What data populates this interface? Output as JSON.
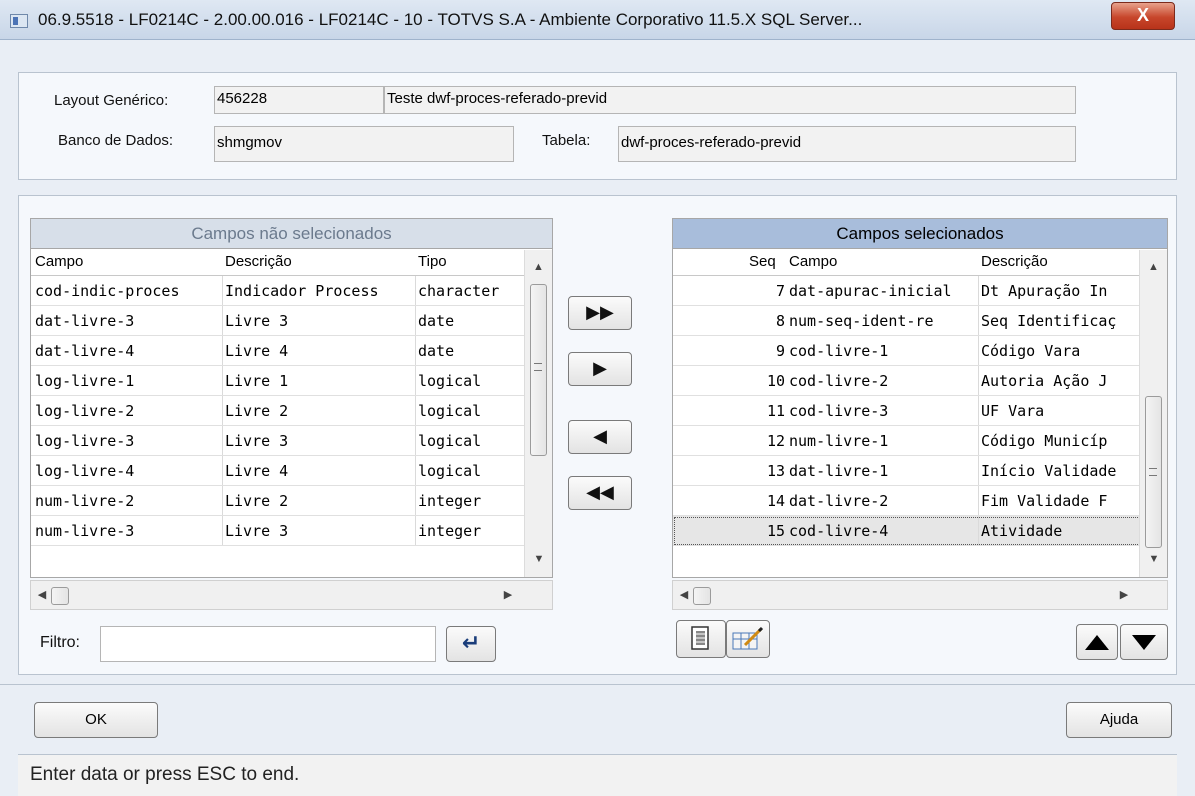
{
  "window": {
    "title": "06.9.5518 - LF0214C - 2.00.00.016 - LF0214C - 10 - TOTVS S.A - Ambiente Corporativo 11.5.X SQL Server...",
    "close_glyph": "X"
  },
  "header": {
    "layout_label": "Layout Genérico:",
    "layout_code": "456228",
    "layout_desc": "Teste dwf-proces-referado-previd",
    "db_label": "Banco de Dados:",
    "db_value": "shmgmov",
    "table_label": "Tabela:",
    "table_value": "dwf-proces-referado-previd"
  },
  "available": {
    "title": "Campos não selecionados",
    "columns": [
      "Campo",
      "Descrição",
      "Tipo"
    ],
    "rows": [
      {
        "campo": "cod-indic-proces",
        "desc": "Indicador Process",
        "tipo": "character"
      },
      {
        "campo": "dat-livre-3",
        "desc": "Livre 3",
        "tipo": "date"
      },
      {
        "campo": "dat-livre-4",
        "desc": "Livre 4",
        "tipo": "date"
      },
      {
        "campo": "log-livre-1",
        "desc": "Livre 1",
        "tipo": "logical"
      },
      {
        "campo": "log-livre-2",
        "desc": "Livre 2",
        "tipo": "logical"
      },
      {
        "campo": "log-livre-3",
        "desc": "Livre 3",
        "tipo": "logical"
      },
      {
        "campo": "log-livre-4",
        "desc": "Livre 4",
        "tipo": "logical"
      },
      {
        "campo": "num-livre-2",
        "desc": "Livre 2",
        "tipo": "integer"
      },
      {
        "campo": "num-livre-3",
        "desc": "Livre 3",
        "tipo": "integer"
      }
    ]
  },
  "selected": {
    "title": "Campos selecionados",
    "columns": [
      "Seq",
      "Campo",
      "Descrição"
    ],
    "rows": [
      {
        "seq": "7",
        "campo": "dat-apurac-inicial",
        "desc": "Dt Apuração In"
      },
      {
        "seq": "8",
        "campo": "num-seq-ident-re",
        "desc": "Seq Identificaç"
      },
      {
        "seq": "9",
        "campo": "cod-livre-1",
        "desc": "Código Vara"
      },
      {
        "seq": "10",
        "campo": "cod-livre-2",
        "desc": "Autoria Ação J"
      },
      {
        "seq": "11",
        "campo": "cod-livre-3",
        "desc": "UF Vara"
      },
      {
        "seq": "12",
        "campo": "num-livre-1",
        "desc": "Código Municíp"
      },
      {
        "seq": "13",
        "campo": "dat-livre-1",
        "desc": "Início Validade"
      },
      {
        "seq": "14",
        "campo": "dat-livre-2",
        "desc": "Fim Validade F"
      },
      {
        "seq": "15",
        "campo": "cod-livre-4",
        "desc": "Atividade"
      }
    ],
    "selected_index": 8
  },
  "move_buttons": {
    "add_all": "▶▶",
    "add_one": "▶",
    "remove_one": "◀",
    "remove_all": "◀◀"
  },
  "filter": {
    "label": "Filtro:",
    "value": "",
    "apply_glyph": "↵"
  },
  "footer": {
    "ok_label": "OK",
    "help_label": "Ajuda"
  },
  "status_text": "Enter data or press ESC to end."
}
